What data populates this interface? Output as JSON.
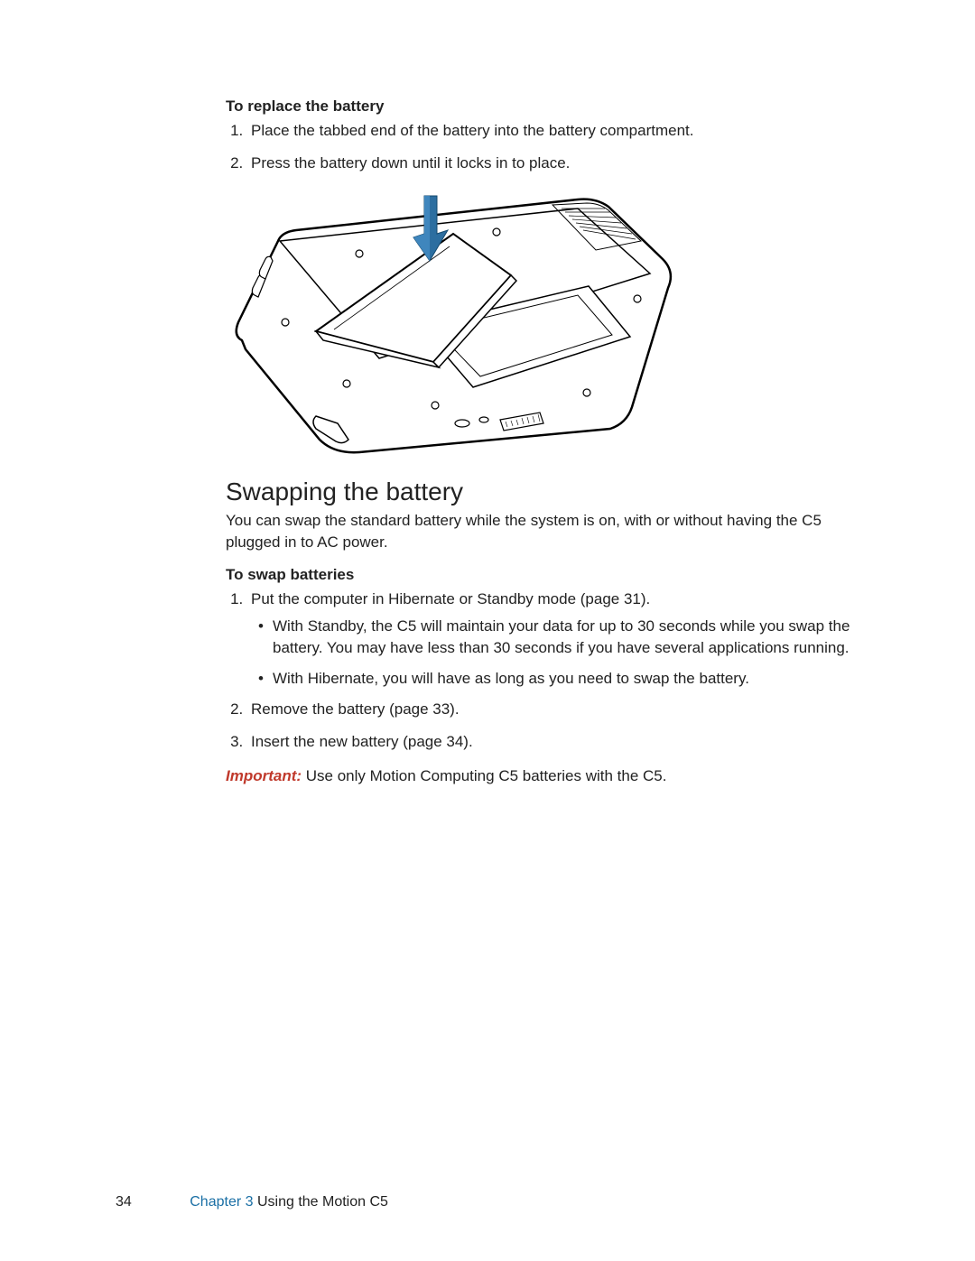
{
  "section1": {
    "heading": "To replace the battery",
    "steps": [
      "Place the tabbed end of the battery into the battery compartment.",
      "Press the battery down until it locks in to place."
    ]
  },
  "section2": {
    "heading": "Swapping the battery",
    "intro": "You can swap the standard battery while the system is on, with or without having the C5 plugged in to AC power."
  },
  "section3": {
    "heading": "To swap batteries",
    "step1": "Put the computer in Hibernate or Standby mode (page 31).",
    "bullets": [
      "With Standby, the C5 will maintain your data for up to 30 seconds while you swap the battery. You may have less than 30 seconds if you have several applications running.",
      "With Hibernate, you will have as long as you need to swap the battery."
    ],
    "step2": "Remove the battery (page 33).",
    "step3": "Insert the new battery (page 34)."
  },
  "important": {
    "label": "Important:",
    "text": " Use only Motion Computing C5 batteries with the C5."
  },
  "footer": {
    "page": "34",
    "chapter_label": "Chapter 3",
    "chapter_title": "  Using the Motion C5"
  }
}
